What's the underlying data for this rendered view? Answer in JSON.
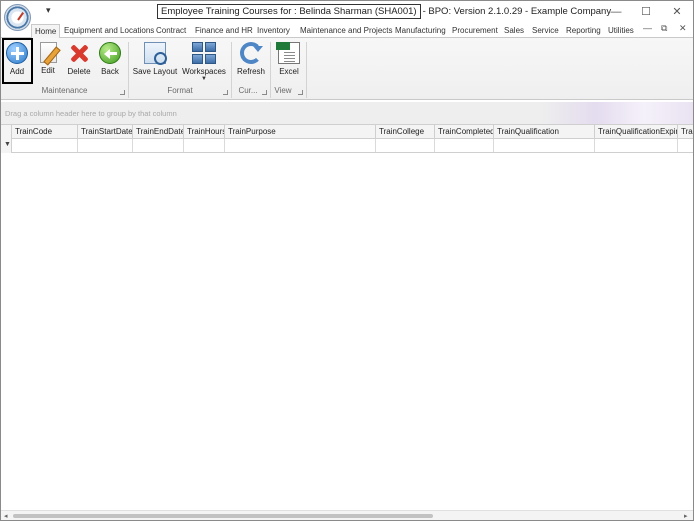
{
  "window": {
    "title_boxed": "Employee Training Courses for : Belinda Sharman (SHA001)",
    "title_rest": "- BPO: Version 2.1.0.29 - Example Company",
    "qat_glyph": "▾",
    "min_glyph": "—",
    "max_glyph": "☐",
    "close_glyph": "✕"
  },
  "tabs": [
    {
      "label": "Home",
      "active": true
    },
    {
      "label": "Equipment and Locations"
    },
    {
      "label": "Contract"
    },
    {
      "label": "Finance and HR"
    },
    {
      "label": "Inventory"
    },
    {
      "label": "Maintenance and Projects"
    },
    {
      "label": "Manufacturing"
    },
    {
      "label": "Procurement"
    },
    {
      "label": "Sales"
    },
    {
      "label": "Service"
    },
    {
      "label": "Reporting"
    },
    {
      "label": "Utilities"
    }
  ],
  "mdi": {
    "min_glyph": "—",
    "restore_glyph": "⧉",
    "close_glyph": "✕"
  },
  "ribbon": {
    "add": "Add",
    "edit": "Edit",
    "delete": "Delete",
    "back": "Back",
    "save_layout": "Save Layout",
    "workspaces": "Workspaces",
    "refresh": "Refresh",
    "excel": "Excel",
    "groups": {
      "maintenance": "Maintenance",
      "format": "Format",
      "current": "Cur...",
      "view": "View"
    },
    "icons": [
      "add-icon",
      "edit-icon",
      "delete-icon",
      "back-icon",
      "save-layout-icon",
      "workspaces-icon",
      "refresh-icon",
      "excel-icon"
    ]
  },
  "grid": {
    "group_hint": "Drag a column header here to group by that column",
    "filter_glyph": "▼",
    "columns": [
      "TrainCode",
      "TrainStartDate",
      "TrainEndDate",
      "TrainHours",
      "TrainPurpose",
      "TrainCollege",
      "TrainCompleted",
      "TrainQualification",
      "TrainQualificationExpiry",
      "Trai"
    ]
  },
  "scrollbar": {
    "left_glyph": "◂",
    "right_glyph": "▸"
  }
}
